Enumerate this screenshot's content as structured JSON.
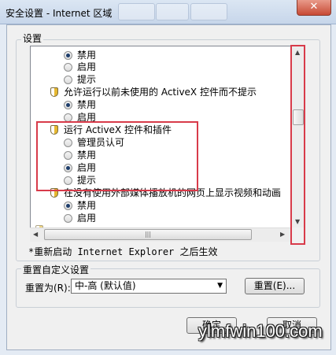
{
  "window": {
    "title": "安全设置 - Internet 区域",
    "close_glyph": "✕"
  },
  "settings_group": {
    "label": "设置"
  },
  "list": {
    "rows": [
      {
        "kind": "radio",
        "label": "禁用",
        "checked": true
      },
      {
        "kind": "radio",
        "label": "启用",
        "checked": false
      },
      {
        "kind": "radio",
        "label": "提示",
        "checked": false
      },
      {
        "kind": "category",
        "label": "允许运行以前未使用的 ActiveX 控件而不提示"
      },
      {
        "kind": "radio",
        "label": "禁用",
        "checked": true
      },
      {
        "kind": "radio",
        "label": "启用",
        "checked": false
      },
      {
        "kind": "category",
        "label": "运行 ActiveX 控件和插件"
      },
      {
        "kind": "radio",
        "label": "管理员认可",
        "checked": false
      },
      {
        "kind": "radio",
        "label": "禁用",
        "checked": false
      },
      {
        "kind": "radio",
        "label": "启用",
        "checked": true
      },
      {
        "kind": "radio",
        "label": "提示",
        "checked": false
      },
      {
        "kind": "category",
        "label": "在没有使用外部媒体播放机的网页上显示视频和动画"
      },
      {
        "kind": "radio",
        "label": "禁用",
        "checked": true
      },
      {
        "kind": "radio",
        "label": "启用",
        "checked": false
      }
    ]
  },
  "restart_note": "*重新启动 Internet Explorer 之后生效",
  "reset_group": {
    "label": "重置自定义设置",
    "reset_to_label": "重置为(R):",
    "selected_level": "中-高 (默认值)",
    "reset_button": "重置(E)..."
  },
  "buttons": {
    "ok": "确定",
    "cancel": "取消"
  },
  "watermark": "ylmfwin100.com",
  "colors": {
    "highlight_box": "#d83b4a"
  }
}
